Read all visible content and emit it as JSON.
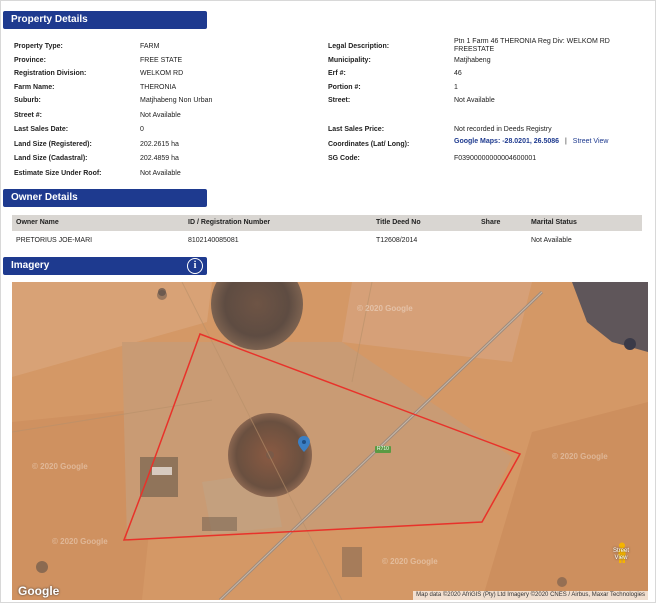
{
  "sections": {
    "property": "Property Details",
    "owner": "Owner Details",
    "imagery": "Imagery"
  },
  "property_left": [
    {
      "label": "Property Type:",
      "value": "FARM"
    },
    {
      "label": "Province:",
      "value": "FREE STATE"
    },
    {
      "label": "Registration Division:",
      "value": "WELKOM RD"
    },
    {
      "label": "Farm Name:",
      "value": "THERONIA"
    },
    {
      "label": "Suburb:",
      "value": "Matjhabeng Non Urban"
    },
    {
      "label": "Street #:",
      "value": "Not Available"
    },
    {
      "label": "Last Sales Date:",
      "value": "0"
    },
    {
      "label": "Land Size (Registered):",
      "value": "202.2615 ha"
    },
    {
      "label": "Land Size (Cadastral):",
      "value": "202.4859 ha"
    },
    {
      "label": "Estimate Size Under Roof:",
      "value": "Not Available"
    }
  ],
  "property_right": [
    {
      "label": "Legal Description:",
      "value": "Ptn 1 Farm 46 THERONIA Reg Div: WELKOM RD FREESTATE"
    },
    {
      "label": "Municipality:",
      "value": "Matjhabeng"
    },
    {
      "label": "Erf #:",
      "value": "46"
    },
    {
      "label": "Portion #:",
      "value": "1"
    },
    {
      "label": "Street:",
      "value": "Not Available"
    },
    {
      "label": "Last Sales Price:",
      "value": "Not recorded in Deeds Registry"
    },
    {
      "label": "Coordinates (Lat/ Long):",
      "value": "Google Maps: -28.0201, 26.5086",
      "link": "Street View",
      "separator": "|"
    },
    {
      "label": "SG Code:",
      "value": "F03900000000004600001"
    }
  ],
  "owner_table": {
    "headers": [
      "Owner Name",
      "ID / Registration Number",
      "Title Deed No",
      "Share",
      "Marital Status"
    ],
    "rows": [
      [
        "PRETORIUS JOE-MARI",
        "8102140085081",
        "T12608/2014",
        "",
        "Not Available"
      ]
    ]
  },
  "imagery": {
    "info_icon": "i",
    "road_label": "R710",
    "google_logo": "Google",
    "watermark": "© 2020 Google",
    "attribution": "Map data ©2020 AfriGIS (Pty) Ltd Imagery ©2020 CNES / Airbus, Maxar Technologies",
    "street_view": "Street View",
    "colors": {
      "terrain": "#d49866",
      "boundary": "#e8322a",
      "marker": "#3b7fc4",
      "section_bar": "#1e3a8f"
    }
  }
}
